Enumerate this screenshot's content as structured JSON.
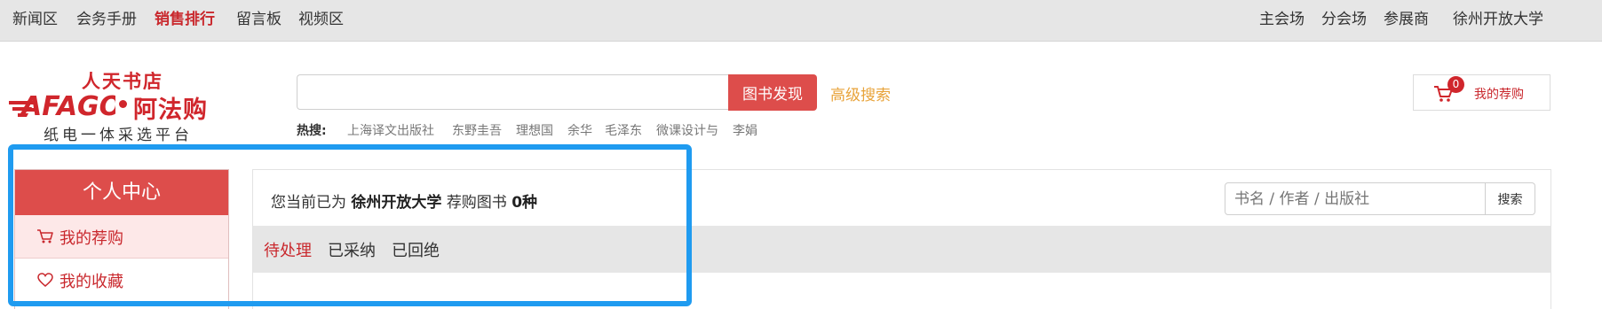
{
  "topnav": {
    "left": [
      "新闻区",
      "会务手册",
      "销售排行",
      "留言板",
      "视频区"
    ],
    "active_index": 2,
    "right": [
      "主会场",
      "分会场",
      "参展商",
      "徐州开放大学"
    ]
  },
  "logo": {
    "shop_name": "人天书店",
    "brand_latin": "AFAGO",
    "brand_cn": "阿法购",
    "slogan": "纸电一体采选平台"
  },
  "search": {
    "value": "",
    "button_label": "图书发现",
    "advanced_label": "高级搜索",
    "hot_label": "热搜:",
    "hot_terms": [
      "上海译文出版社",
      "东野圭吾",
      "理想国",
      "余华",
      "毛泽东",
      "微课设计与",
      "李娟"
    ]
  },
  "cart": {
    "count": "0",
    "label": "我的荐购",
    "icon": "cart-icon"
  },
  "sidebar": {
    "title": "个人中心",
    "items": [
      {
        "label": "我的荐购",
        "icon": "cart-icon"
      },
      {
        "label": "我的收藏",
        "icon": "heart-icon"
      }
    ]
  },
  "main": {
    "status_prefix": "您当前已为",
    "org_name": "徐州开放大学",
    "status_middle": "荐购图书",
    "count_text": "0种",
    "search_placeholder": "书名 / 作者 / 出版社",
    "search_button": "搜索",
    "tabs": [
      "待处理",
      "已采纳",
      "已回绝"
    ],
    "active_tab": 0
  },
  "colors": {
    "brand_red": "#d0262c",
    "button_red": "#dd4d4b",
    "advanced_orange": "#e8a33a",
    "highlight_blue": "#1f9bf0"
  }
}
